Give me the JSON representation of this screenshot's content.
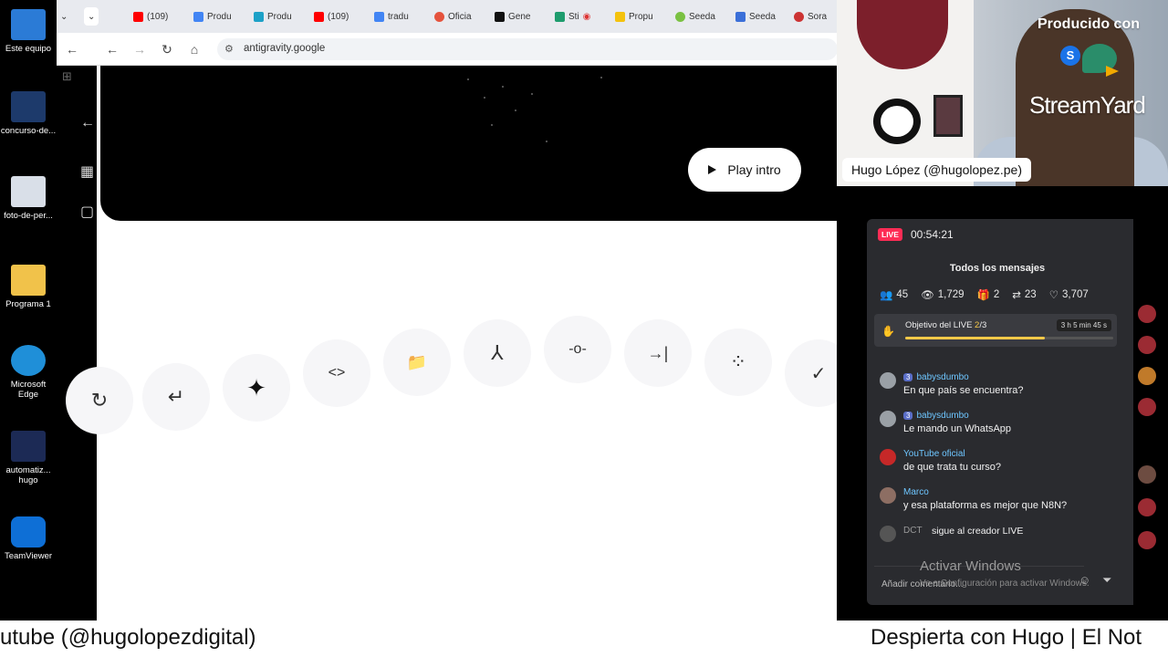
{
  "desktop": {
    "icons": [
      {
        "label": "Este equipo",
        "color": "#2b7bd6"
      },
      {
        "label": "concurso-de...",
        "color": "#1d3a6b"
      },
      {
        "label": "foto-de-per...",
        "color": "#d9dfe8"
      },
      {
        "label": "Programa 1",
        "color": "#f1c24a"
      },
      {
        "label": "Microsoft\nEdge",
        "color": "#1f8fd8"
      },
      {
        "label": "automatiz...\nhugo",
        "color": "#1c2a55"
      },
      {
        "label": "TeamViewer",
        "color": "#0e6fd6"
      }
    ]
  },
  "browser": {
    "tabs": [
      {
        "label": "(109)",
        "color": "#ff0000"
      },
      {
        "label": "Produ",
        "color": "#4285f4"
      },
      {
        "label": "Produ",
        "color": "#1da1c7"
      },
      {
        "label": "(109)",
        "color": "#ff0000"
      },
      {
        "label": "tradu",
        "color": "#4285f4"
      },
      {
        "label": "Oficia",
        "color": "#e5533d"
      },
      {
        "label": "Gene",
        "color": "#111111"
      },
      {
        "label": "Sti",
        "color": "#1e9c6d"
      },
      {
        "label": "Propu",
        "color": "#f4c20d"
      },
      {
        "label": "Seeda",
        "color": "#7ac142"
      },
      {
        "label": "Seeda",
        "color": "#3b6fd8"
      },
      {
        "label": "Sora",
        "color": "#cc3333"
      }
    ],
    "url": "antigravity.google",
    "hero": {
      "play_label": "Play intro"
    },
    "keycaps": [
      "↻",
      "↵",
      "✦",
      "<>",
      "📁",
      "⅄",
      "-o-",
      "→|",
      "⁘",
      "✓"
    ]
  },
  "stream": {
    "produced_by": "Producido con",
    "brand": "StreamYard",
    "host": "Hugo López (@hugolopez.pe)"
  },
  "live": {
    "badge": "LIVE",
    "timer": "00:54:21",
    "title": "Todos los mensajes",
    "stats": [
      {
        "icon": "users-icon",
        "glyph": "👥",
        "value": "45"
      },
      {
        "icon": "eye-icon",
        "glyph": "👁",
        "value": "1,729"
      },
      {
        "icon": "gift-icon",
        "glyph": "🎁",
        "value": "2"
      },
      {
        "icon": "share-icon",
        "glyph": "⇄",
        "value": "23"
      },
      {
        "icon": "heart-icon",
        "glyph": "♡",
        "value": "3,707"
      }
    ],
    "goal": {
      "label_prefix": "Objetivo del LIVE",
      "current": "2",
      "total": "/3",
      "time_left": "3 h 5 min 45 s",
      "progress": 0.67
    },
    "messages": [
      {
        "user": "babysdumbo",
        "level": "3",
        "text": "En que país se encuentra?",
        "avatar": "#9aa0a6"
      },
      {
        "user": "babysdumbo",
        "level": "3",
        "text": "Le mando un WhatsApp",
        "avatar": "#9aa0a6"
      },
      {
        "user": "YouTube oficial",
        "level": "",
        "text": "de que trata tu curso?",
        "avatar": "#c62828"
      },
      {
        "user": "Marco",
        "level": "",
        "text": "y esa plataforma es mejor que N8N?",
        "avatar": "#8d6e63"
      }
    ],
    "follow_notice": {
      "user": "DCT",
      "text": "sigue al creador LIVE"
    },
    "watermark": "Activar Windows",
    "watermark_sub": "Ve a Configuración para activar Windows.",
    "comment_placeholder": "Añadir comentario..."
  },
  "ticker": {
    "left": "utube (@hugolopezdigital)",
    "right": "Despierta con Hugo | El Not"
  }
}
